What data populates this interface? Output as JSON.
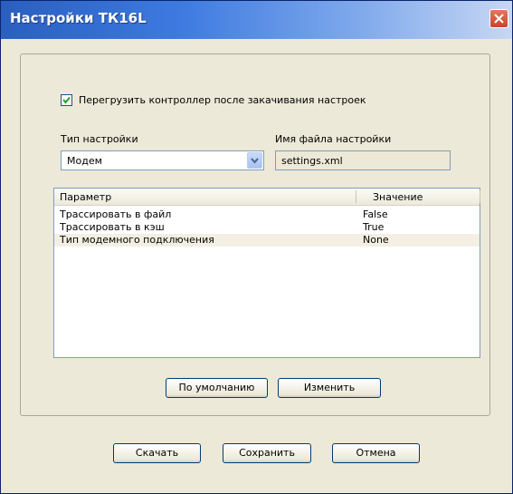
{
  "window": {
    "title": "Настройки ТК16L"
  },
  "options": {
    "reboot_checked": true,
    "reboot_label": "Перегрузить контроллер после закачивания настроек"
  },
  "settings_type": {
    "label": "Тип настройки",
    "value": "Модем"
  },
  "settings_file": {
    "label": "Имя файла настройки",
    "value": "settings.xml"
  },
  "params": {
    "columns": [
      "Параметр",
      "Значение"
    ],
    "rows": [
      {
        "name": "Трассировать в файл",
        "value": "False"
      },
      {
        "name": "Трассировать в кэш",
        "value": "True"
      },
      {
        "name": "Тип модемного подключения",
        "value": "None"
      }
    ]
  },
  "buttons": {
    "default": "По умолчанию",
    "change": "Изменить",
    "download": "Скачать",
    "save": "Сохранить",
    "cancel": "Отмена"
  }
}
